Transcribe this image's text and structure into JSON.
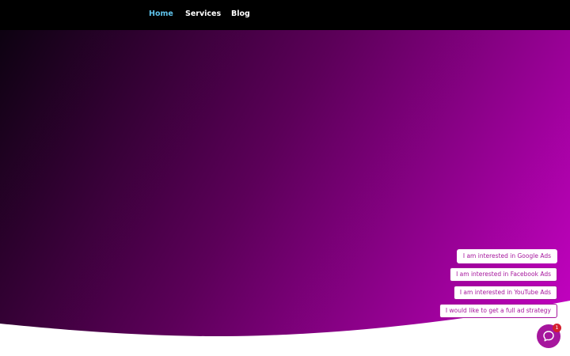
{
  "nav": {
    "home_label": "Home",
    "services_label": "Services",
    "blog_label": "Blog"
  },
  "hero": {
    "gradient_start": "#0d0211",
    "gradient_mid": "#5c0059",
    "gradient_end": "#c802c6"
  },
  "chat": {
    "quick_replies": [
      "I am interested in Google Ads",
      "I am interested in Facebook Ads",
      "I am interested in YouTube Ads",
      "I would like to get a full ad strategy"
    ],
    "badge_count": "1",
    "icon": "chat-bubble-icon",
    "accent_color": "#a6169d"
  },
  "colors": {
    "nav_background": "#000000",
    "nav_active": "#5fc3ec",
    "nav_text": "#ffffff"
  }
}
